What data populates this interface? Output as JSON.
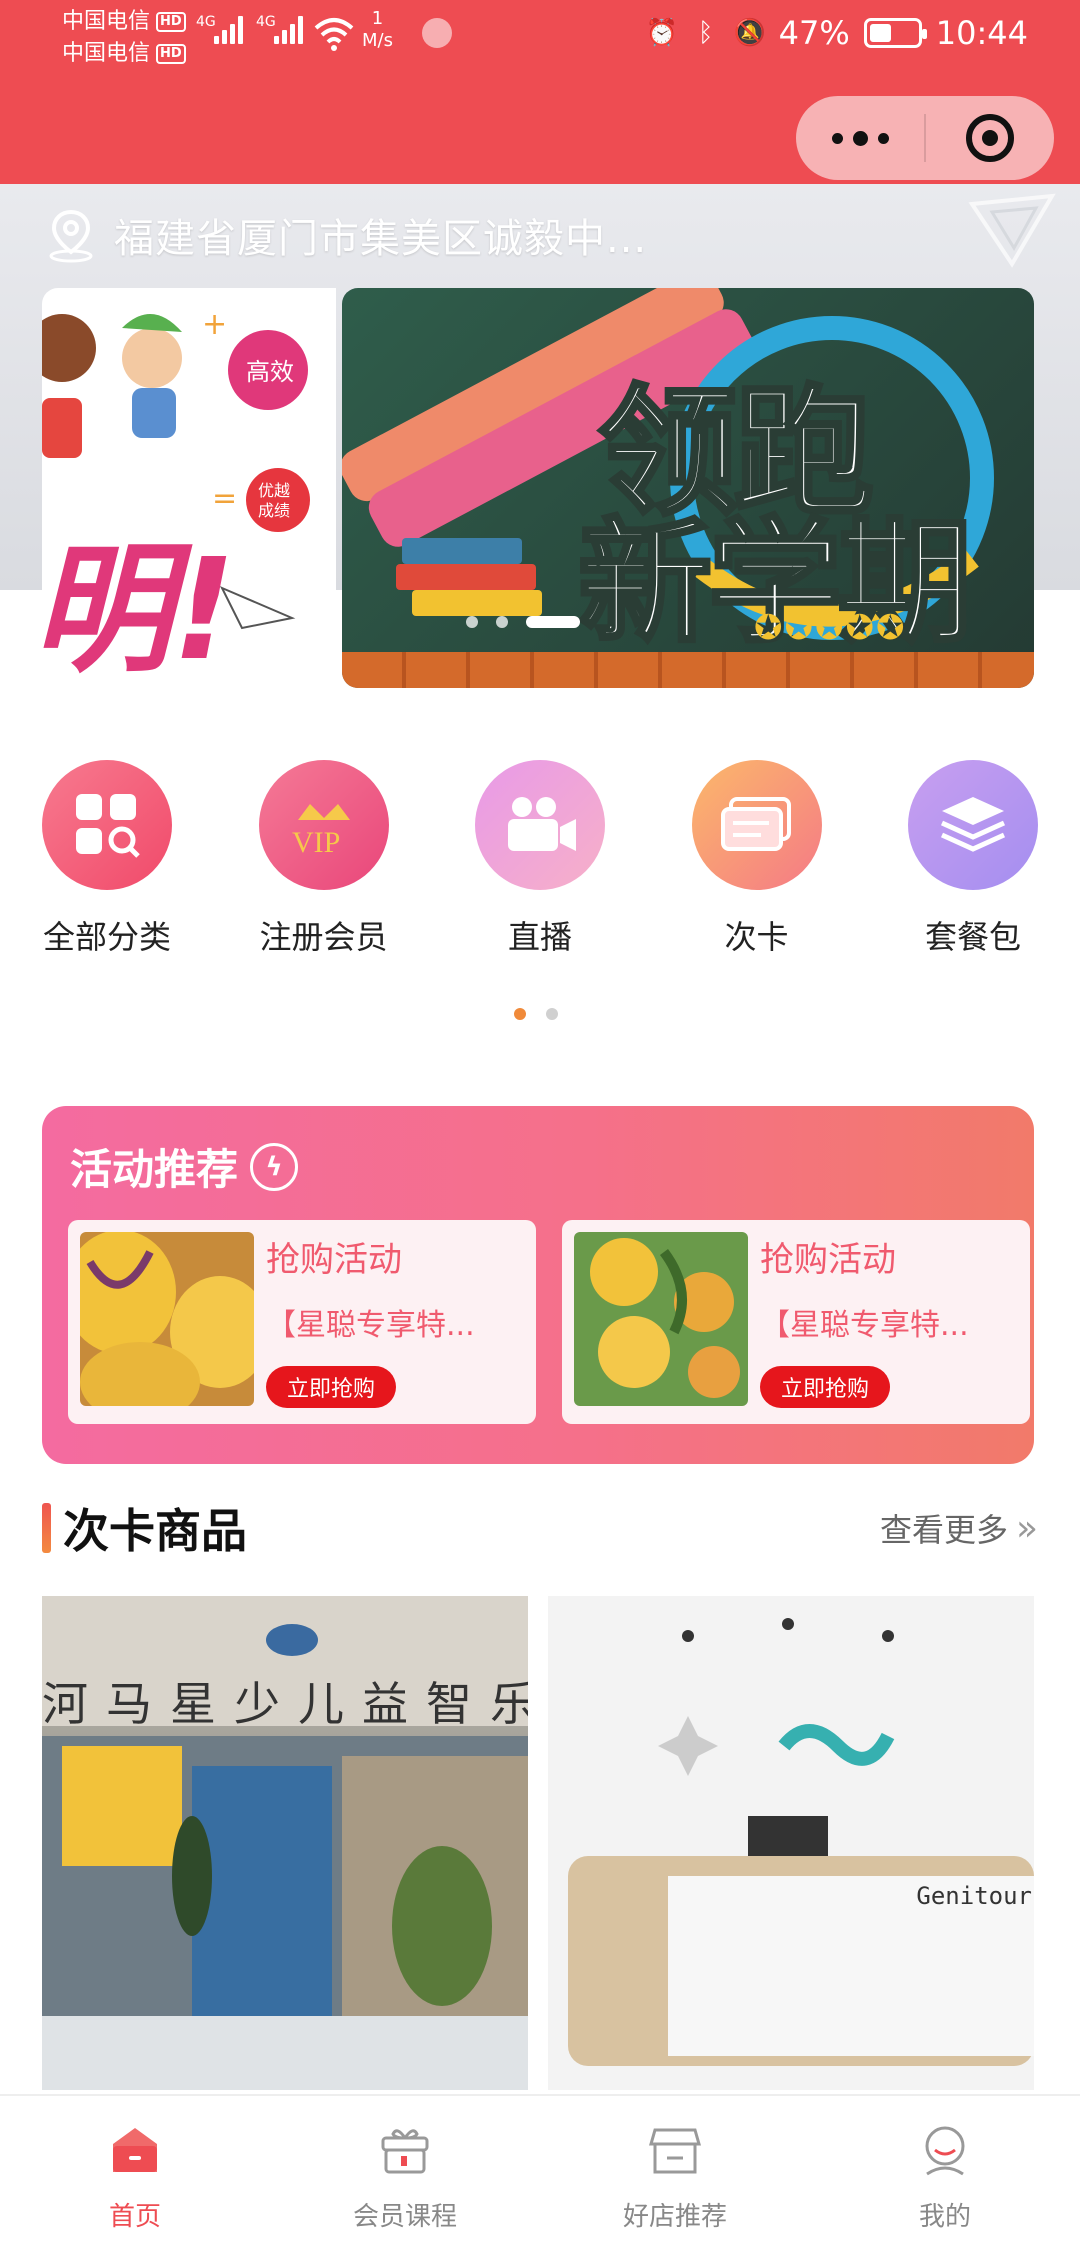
{
  "status_bar": {
    "carrier1": "中国电信",
    "carrier2": "中国电信",
    "hd": "HD",
    "net": "4G",
    "speed_value": "1",
    "speed_unit": "M/s",
    "battery": "47%",
    "time": "10:44"
  },
  "location": {
    "text": "福建省厦门市集美区诚毅中..."
  },
  "banner": {
    "title_line1": "领跑",
    "title_line2": "新学期",
    "left_slide_tag1": "高效",
    "left_slide_tag2": "优越成绩",
    "active_index": 2,
    "count": 3
  },
  "categories": [
    {
      "label": "全部分类",
      "icon": "grid-search-icon",
      "color_from": "#f77a8f",
      "color_to": "#f14a6a"
    },
    {
      "label": "注册会员",
      "icon": "vip-crown-icon",
      "color_from": "#f57a96",
      "color_to": "#e9467a"
    },
    {
      "label": "直播",
      "icon": "video-camera-icon",
      "color_from": "#e89ae8",
      "color_to": "#f7b0c8"
    },
    {
      "label": "次卡",
      "icon": "ticket-card-icon",
      "color_from": "#fbb86a",
      "color_to": "#f57a86"
    },
    {
      "label": "套餐包",
      "icon": "layers-icon",
      "color_from": "#c89ff0",
      "color_to": "#a48ef0"
    }
  ],
  "activity": {
    "title": "活动推荐",
    "cards": [
      {
        "name": "抢购活动",
        "desc": "【星聪专享特...",
        "button": "立即抢购"
      },
      {
        "name": "抢购活动",
        "desc": "【星聪专享特...",
        "button": "立即抢购"
      }
    ]
  },
  "section": {
    "title": "次卡商品",
    "more": "查看更多"
  },
  "products": [
    {
      "sign": "河马星少儿益智乐"
    },
    {
      "sign": "Genitour"
    }
  ],
  "tabs": [
    {
      "label": "首页",
      "icon": "home-bag-icon",
      "active": true
    },
    {
      "label": "会员课程",
      "icon": "gift-box-icon",
      "active": false
    },
    {
      "label": "好店推荐",
      "icon": "shop-icon",
      "active": false
    },
    {
      "label": "我的",
      "icon": "user-icon",
      "active": false
    }
  ],
  "colors": {
    "brand_red": "#ee4c52",
    "accent_orange": "#f08a3a",
    "buy_button": "#e6161c"
  }
}
